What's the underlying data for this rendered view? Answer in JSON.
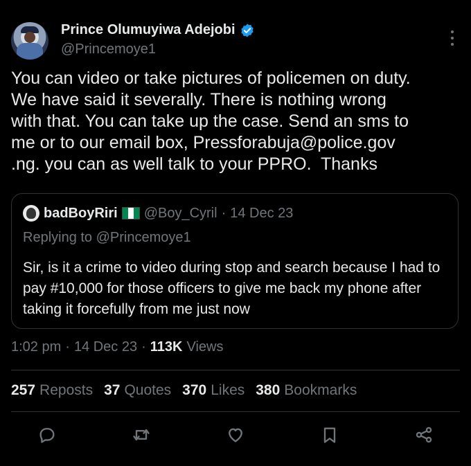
{
  "author": {
    "name": "Prince Olumuyiwa Adejobi",
    "handle": "@Princemoye1"
  },
  "tweet": {
    "text": "You can video or take pictures of policemen on duty.\nWe have said it severally. There is nothing wrong\nwith that. You can take up the case. Send an sms to\nme or to our email box, Pressforabuja@police.gov\n.ng. you can as well talk to your PPRO.  Thanks"
  },
  "quote": {
    "name": "badBoyRiri",
    "handle": "@Boy_Cyril",
    "separator": "·",
    "date": "14 Dec 23",
    "replying": "Replying to @Princemoye1",
    "text": "Sir, is it a crime to video during stop and search because I had to pay #10,000 for those officers to give me back my phone after taking it forcefully from me just now"
  },
  "meta": {
    "time": "1:02 pm",
    "sep1": "·",
    "date": "14 Dec 23",
    "sep2": "·",
    "views_count": "113K",
    "views_label": "Views"
  },
  "stats": {
    "reposts": {
      "num": "257",
      "label": "Reposts"
    },
    "quotes": {
      "num": "37",
      "label": "Quotes"
    },
    "likes": {
      "num": "370",
      "label": "Likes"
    },
    "bookmarks": {
      "num": "380",
      "label": "Bookmarks"
    }
  },
  "icons": {
    "verified": "verified-badge-icon",
    "more": "more-icon",
    "reply": "reply-icon",
    "repost": "repost-icon",
    "like": "like-icon",
    "bookmark": "bookmark-icon",
    "share": "share-icon"
  },
  "colors": {
    "background": "#000000",
    "text": "#e7e9ea",
    "secondary": "#71767b",
    "verified": "#1d9bf0",
    "border": "#2f3336"
  }
}
